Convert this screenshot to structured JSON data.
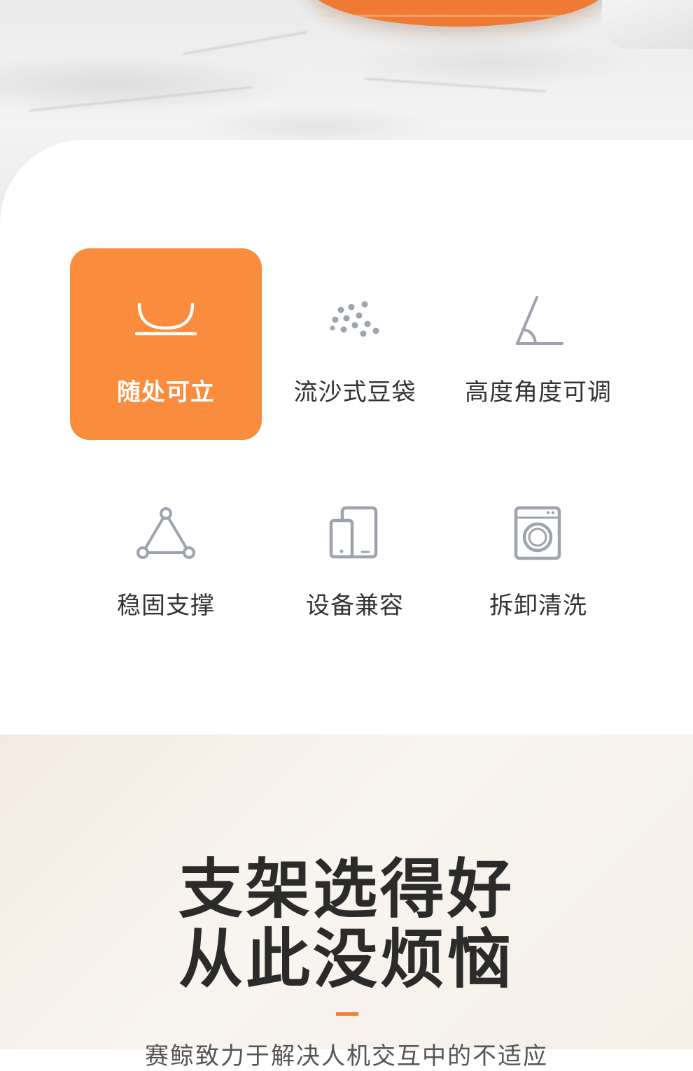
{
  "features": [
    {
      "label": "随处可立",
      "icon": "bowl-icon",
      "active": true
    },
    {
      "label": "流沙式豆袋",
      "icon": "beads-icon",
      "active": false
    },
    {
      "label": "高度角度可调",
      "icon": "angle-icon",
      "active": false
    },
    {
      "label": "稳固支撑",
      "icon": "triangle-icon",
      "active": false
    },
    {
      "label": "设备兼容",
      "icon": "devices-icon",
      "active": false
    },
    {
      "label": "拆卸清洗",
      "icon": "washing-machine-icon",
      "active": false
    }
  ],
  "headline": {
    "line1": "支架选得好",
    "line2": "从此没烦恼"
  },
  "subtext": "赛鲸致力于解决人机交互中的不适应",
  "colors": {
    "accent": "#f98c3d",
    "icon_gray": "#9ea3ad",
    "text_dark": "#333333"
  }
}
